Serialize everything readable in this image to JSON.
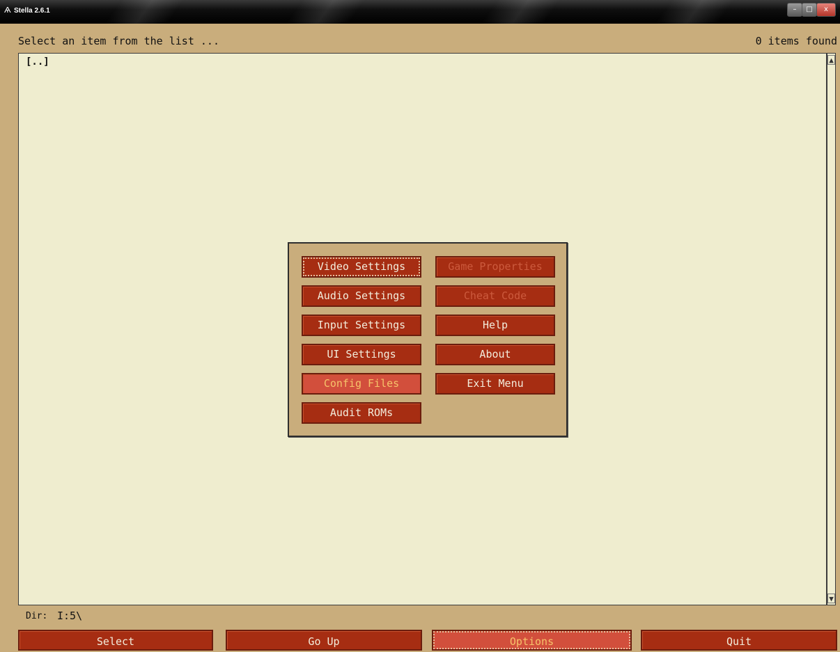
{
  "window": {
    "title": "Stella 2.6.1",
    "logo_icon": "atari-logo-icon",
    "controls": {
      "minimize": "–",
      "maximize": "□",
      "close": "x"
    }
  },
  "header": {
    "prompt": "Select an item from the list ...",
    "count": "0 items found"
  },
  "list": {
    "items": [
      "[..]"
    ]
  },
  "dir": {
    "label": "Dir:",
    "value": "I:5\\"
  },
  "options_dialog": {
    "left_column": [
      {
        "label": "Video Settings",
        "state": "focused"
      },
      {
        "label": "Audio Settings",
        "state": "normal"
      },
      {
        "label": "Input Settings",
        "state": "normal"
      },
      {
        "label": "UI Settings",
        "state": "normal"
      },
      {
        "label": "Config Files",
        "state": "highlighted"
      },
      {
        "label": "Audit ROMs",
        "state": "normal"
      }
    ],
    "right_column": [
      {
        "label": "Game Properties",
        "state": "disabled"
      },
      {
        "label": "Cheat Code",
        "state": "disabled"
      },
      {
        "label": "Help",
        "state": "normal"
      },
      {
        "label": "About",
        "state": "normal"
      },
      {
        "label": "Exit Menu",
        "state": "normal"
      }
    ]
  },
  "bottom_buttons": [
    "Select",
    "Go Up",
    "Options",
    "Quit"
  ],
  "colors": {
    "background": "#c9ad7c",
    "list_background": "#efedcf",
    "button": "#a62d12",
    "button_highlight": "#d24f3c",
    "highlight_text": "#f6c36a"
  }
}
